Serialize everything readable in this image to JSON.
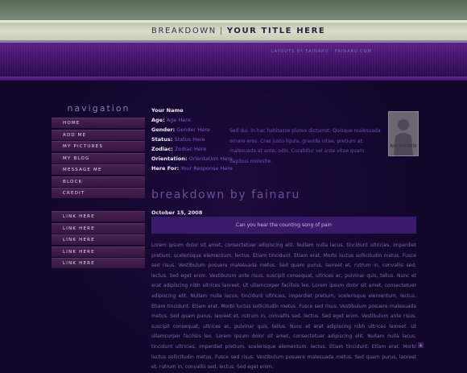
{
  "banner": {
    "brand": "BREAKDOWN",
    "separator": "|",
    "title": "YOUR TITLE HERE",
    "tagline": "LAYOUTS BY FAINARU  ·  FAINARU.COM"
  },
  "nav": {
    "title": "navigation",
    "items": [
      "HOME",
      "ADD ME",
      "MY PICTURES",
      "MY BLOG",
      "MESSAGE ME",
      "BLOCK",
      "CREDIT"
    ]
  },
  "links": {
    "items": [
      "LINK HERE",
      "LINK HERE",
      "LINK HERE",
      "LINK HERE",
      "LINK HERE"
    ]
  },
  "profile": {
    "name_label": "Your Name",
    "age_label": "Age:",
    "age_value": "Age Here",
    "gender_label": "Gender:",
    "gender_value": "Gender Here",
    "status_label": "Status:",
    "status_value": "Status Here",
    "zodiac_label": "Zodiac:",
    "zodiac_value": "Zodiac Here",
    "orientation_label": "Orientation:",
    "orientation_value": "Orientation Here",
    "herefor_label": "Here For:",
    "herefor_value": "Your Response Here",
    "about": "Sed dui. In hac habitasse platea dictumst. Quisque malesuada ornare eros. Cras justo ligula, gravida vitae, pretium at, malesuada at ante, odio. Curabitur vel ante vitae quam dapibus molestie.",
    "photo_label": "NO PHOTO"
  },
  "blog": {
    "title": "breakdown by fainaru",
    "date": "October 15, 2008",
    "quote": "Can you hear the counting song of pain",
    "body": "Lorem ipsum dolor sit amet, consectetuer adipiscing elit. Nullam nulla lacus, tincidunt ultricies, imperdiet pretium, scelerisque elementum, lectus. Etiam tincidunt. Etiam erat. Morbi luctus sollicitudin metus. Fusce sed risus. Vestibulum posuere malesuada metus. Sed quam purus, laoreet et, rutrum in, convallis sed, lectus. Sed eget enim. Vestibulum ante risus, suscipit consequat, ultrices ac, pulvinar quis, tellus. Nunc et erat adipiscing nibh ultrices laoreet. Ut ullamcorper facilisis leo. Lorem ipsum dolor sit amet, consectetuer adipiscing elit. Nullam nulla lacus, tincidunt ultricies, imperdiet pretium, scelerisque elementum, lectus. Etiam tincidunt. Etiam erat. Morbi luctus sollicitudin metus. Fusce sed risus. Vestibulum posuere malesuada metus. Sed quam purus, laoreet et, rutrum in, convallis sed, lectus. Sed eget enim. Vestibulum ante risus, suscipit consequat, ultrices ac, pulvinar quis, tellus. Nunc et erat adipiscing nibh ultrices laoreet. Ut ullamcorper facilisis leo. Lorem ipsum dolor sit amet, consectetuer adipiscing elit. Nullam nulla lacus, tincidunt ultricies, imperdiet pretium, scelerisque elementum, lectus. Etiam tincidunt. Etiam erat. Morbi luctus sollicitudin metus. Fusce sed risus. Vestibulum posuere malesuada metus. Sed quam purus, laoreet et, rutrum in, convallis sed, lectus. Sed eget enim."
  },
  "colors": {
    "accent": "#7d58c9",
    "nav_bg": "#3c1c46",
    "quote_bg": "#3c1a6b"
  },
  "icons": {
    "scroll": "chevron-up-icon"
  }
}
